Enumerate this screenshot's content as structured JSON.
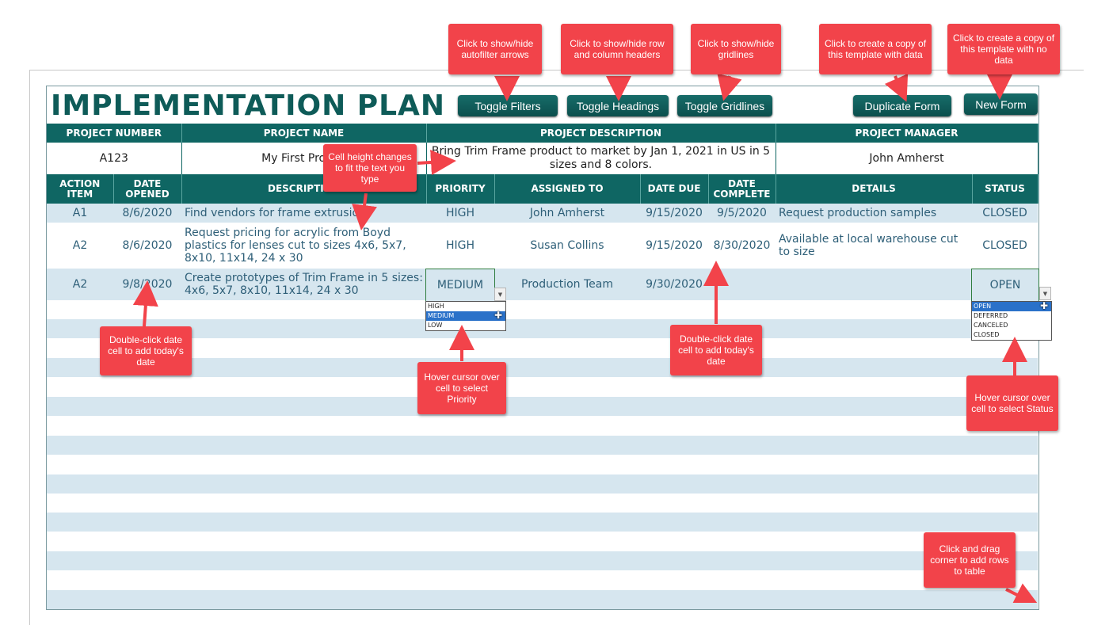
{
  "title": "IMPLEMENTATION  PLAN",
  "toolbar": {
    "toggle_filters": "Toggle Filters",
    "toggle_headings": "Toggle Headings",
    "toggle_gridlines": "Toggle Gridlines",
    "duplicate_form": "Duplicate Form",
    "new_form": "New Form"
  },
  "project": {
    "headers": {
      "number": "PROJECT NUMBER",
      "name": "PROJECT NAME",
      "description": "PROJECT DESCRIPTION",
      "manager": "PROJECT MANAGER"
    },
    "number": "A123",
    "name": "My First Project",
    "description": "Bring Trim Frame product to market by Jan 1, 2021 in US in 5 sizes and 8 colors.",
    "manager": "John Amherst"
  },
  "table": {
    "columns": {
      "action_item": "ACTION ITEM",
      "date_opened": "DATE OPENED",
      "description": "DESCRIPTION",
      "priority": "PRIORITY",
      "assigned_to": "ASSIGNED TO",
      "date_due": "DATE DUE",
      "date_complete": "DATE COMPLETE",
      "details": "DETAILS",
      "status": "STATUS"
    },
    "rows": [
      {
        "action_item": "A1",
        "date_opened": "8/6/2020",
        "description": "Find vendors for frame extrusion",
        "priority": "HIGH",
        "assigned_to": "John Amherst",
        "date_due": "9/15/2020",
        "date_complete": "9/5/2020",
        "details": "Request production samples",
        "status": "CLOSED"
      },
      {
        "action_item": "A2",
        "date_opened": "8/6/2020",
        "description": "Request pricing for acrylic from Boyd plastics for lenses cut to sizes 4x6, 5x7, 8x10, 11x14, 24 x 30",
        "priority": "HIGH",
        "assigned_to": "Susan Collins",
        "date_due": "9/15/2020",
        "date_complete": "8/30/2020",
        "details": "Available at local warehouse cut to size",
        "status": "CLOSED"
      },
      {
        "action_item": "A2",
        "date_opened": "9/8/2020",
        "description": "Create prototypes of Trim Frame in 5 sizes: 4x6, 5x7, 8x10, 11x14, 24 x 30",
        "priority": "MEDIUM",
        "assigned_to": "Production Team",
        "date_due": "9/30/2020",
        "date_complete": "",
        "details": "",
        "status": "OPEN"
      }
    ]
  },
  "priority_dropdown": {
    "options": [
      "HIGH",
      "MEDIUM",
      "LOW"
    ],
    "highlighted": "MEDIUM"
  },
  "status_dropdown": {
    "options": [
      "OPEN",
      "DEFERRED",
      "CANCELED",
      "CLOSED"
    ],
    "highlighted": "OPEN"
  },
  "callouts": {
    "filters": "Click to show/hide autofilter arrows",
    "headings": "Click to show/hide row and column headers",
    "gridlines": "Click to show/hide gridlines",
    "duplicate": "Click to create a copy of this template with data",
    "new_form": "Click to create a copy of this template with no data",
    "cell_height": "Cell height changes to fit the text you type",
    "date_opened": "Double-click date cell to add today's date",
    "date_complete": "Double-click date cell to add today's date",
    "priority": "Hover cursor over cell to select  Priority",
    "status": "Hover cursor over cell to select  Status",
    "add_rows": "Click and drag corner to add rows to table"
  },
  "colors": {
    "header_teal": "#0f6663",
    "stripe_blue": "#d6e6ef",
    "callout_red": "#f2434a",
    "row_text": "#2e5f78"
  }
}
